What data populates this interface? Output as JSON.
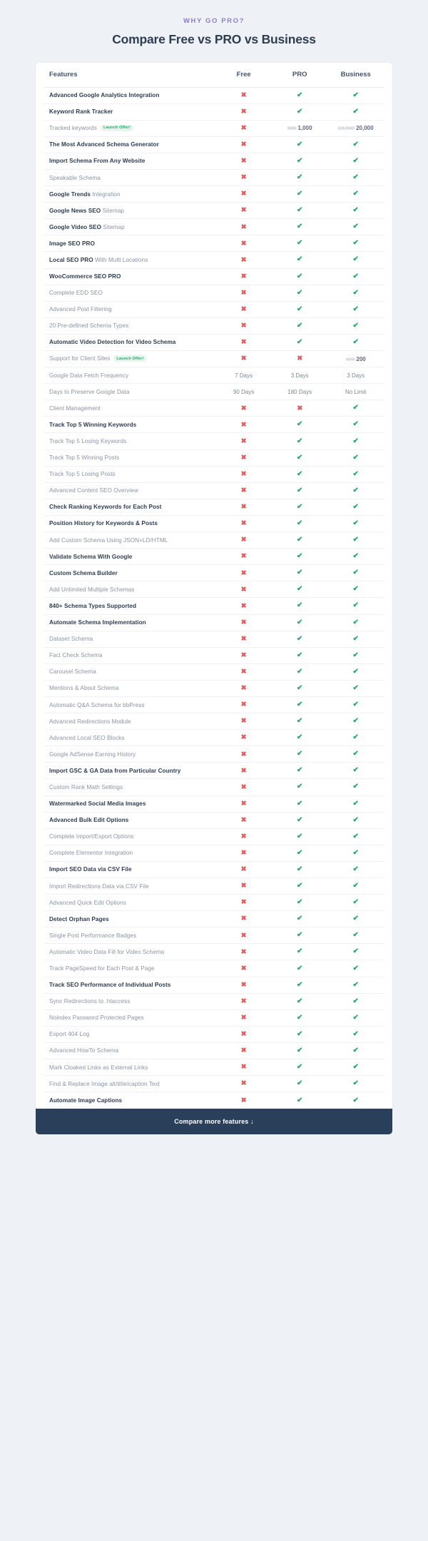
{
  "header": {
    "eyebrow": "WHY GO PRO?",
    "title": "Compare Free vs PRO vs Business"
  },
  "table": {
    "columns": [
      "Features",
      "Free",
      "PRO",
      "Business"
    ],
    "badge_label": "Launch Offer!",
    "icons": {
      "cross": "✖",
      "check": "✔"
    },
    "rows": [
      {
        "feature": "Advanced Google Analytics Integration",
        "bold": true,
        "free": "cross",
        "pro": "check",
        "business": "check"
      },
      {
        "feature": "Keyword Rank Tracker",
        "bold": true,
        "free": "cross",
        "pro": "check",
        "business": "check"
      },
      {
        "feature": "Tracked keywords",
        "bold": false,
        "badge": true,
        "free": "cross",
        "pro": {
          "old": "500",
          "new": "1,000"
        },
        "business": {
          "old": "10,000",
          "new": "20,000"
        }
      },
      {
        "feature": "The Most Advanced Schema Generator",
        "bold": true,
        "free": "cross",
        "pro": "check",
        "business": "check"
      },
      {
        "feature": "Import Schema From Any Website",
        "bold": true,
        "free": "cross",
        "pro": "check",
        "business": "check"
      },
      {
        "feature": "Speakable Schema",
        "bold": false,
        "free": "cross",
        "pro": "check",
        "business": "check"
      },
      {
        "feature": "Google Trends",
        "suffix": " Integration",
        "bold": true,
        "free": "cross",
        "pro": "check",
        "business": "check"
      },
      {
        "feature": "Google News SEO",
        "suffix": " Sitemap",
        "bold": true,
        "free": "cross",
        "pro": "check",
        "business": "check"
      },
      {
        "feature": "Google Video SEO",
        "suffix": " Sitemap",
        "bold": true,
        "free": "cross",
        "pro": "check",
        "business": "check"
      },
      {
        "feature": "Image SEO PRO",
        "bold": true,
        "free": "cross",
        "pro": "check",
        "business": "check"
      },
      {
        "feature": "Local SEO PRO",
        "suffix": " With Multi Locations",
        "bold": true,
        "free": "cross",
        "pro": "check",
        "business": "check"
      },
      {
        "feature": "WooCommerce SEO PRO",
        "bold": true,
        "free": "cross",
        "pro": "check",
        "business": "check"
      },
      {
        "feature": "Complete EDD SEO",
        "bold": false,
        "free": "cross",
        "pro": "check",
        "business": "check"
      },
      {
        "feature": "Advanced Post Filtering",
        "bold": false,
        "free": "cross",
        "pro": "check",
        "business": "check"
      },
      {
        "feature": "20 Pre-defined Schema Types",
        "bold": false,
        "free": "cross",
        "pro": "check",
        "business": "check"
      },
      {
        "feature": "Automatic Video Detection for Video Schema",
        "bold": true,
        "free": "cross",
        "pro": "check",
        "business": "check"
      },
      {
        "feature": "Support for Client Sites",
        "bold": false,
        "badge": true,
        "free": "cross",
        "pro": "cross",
        "business": {
          "old": "100",
          "new": "200"
        }
      },
      {
        "feature": "Google Data Fetch Frequency",
        "bold": false,
        "free": "7 Days",
        "pro": "3 Days",
        "business": "3 Days"
      },
      {
        "feature": "Days to Preserve Google Data",
        "bold": false,
        "free": "90 Days",
        "pro": "180 Days",
        "business": "No Limit"
      },
      {
        "feature": "Client Management",
        "bold": false,
        "free": "cross",
        "pro": "cross",
        "business": "check"
      },
      {
        "feature": "Track Top 5 Winning Keywords",
        "bold": true,
        "free": "cross",
        "pro": "check",
        "business": "check"
      },
      {
        "feature": "Track Top 5 Losing Keywords",
        "bold": false,
        "free": "cross",
        "pro": "check",
        "business": "check"
      },
      {
        "feature": "Track Top 5 Winning Posts",
        "bold": false,
        "free": "cross",
        "pro": "check",
        "business": "check"
      },
      {
        "feature": "Track Top 5 Losing Posts",
        "bold": false,
        "free": "cross",
        "pro": "check",
        "business": "check"
      },
      {
        "feature": "Advanced Content SEO Overview",
        "bold": false,
        "free": "cross",
        "pro": "check",
        "business": "check"
      },
      {
        "feature": "Check Ranking Keywords for Each Post",
        "bold": true,
        "free": "cross",
        "pro": "check",
        "business": "check"
      },
      {
        "feature": "Position History for Keywords & Posts",
        "bold": true,
        "free": "cross",
        "pro": "check",
        "business": "check"
      },
      {
        "feature": "Add Custom Schema Using JSON+LD/HTML",
        "bold": false,
        "free": "cross",
        "pro": "check",
        "business": "check"
      },
      {
        "feature": "Validate Schema With Google",
        "bold": true,
        "free": "cross",
        "pro": "check",
        "business": "check"
      },
      {
        "feature": "Custom Schema Builder",
        "bold": true,
        "free": "cross",
        "pro": "check",
        "business": "check"
      },
      {
        "feature": "Add Unlimited Multiple Schemas",
        "bold": false,
        "free": "cross",
        "pro": "check",
        "business": "check"
      },
      {
        "feature": "840+ Schema Types Supported",
        "bold": true,
        "free": "cross",
        "pro": "check",
        "business": "check"
      },
      {
        "feature": "Automate Schema Implementation",
        "bold": true,
        "free": "cross",
        "pro": "check",
        "business": "check"
      },
      {
        "feature": "Dataset Schema",
        "bold": false,
        "free": "cross",
        "pro": "check",
        "business": "check"
      },
      {
        "feature": "Fact Check Schema",
        "bold": false,
        "free": "cross",
        "pro": "check",
        "business": "check"
      },
      {
        "feature": "Carousel Schema",
        "bold": false,
        "free": "cross",
        "pro": "check",
        "business": "check"
      },
      {
        "feature": "Mentions & About Schema",
        "bold": false,
        "free": "cross",
        "pro": "check",
        "business": "check"
      },
      {
        "feature": "Automatic Q&A Schema for bbPress",
        "bold": false,
        "free": "cross",
        "pro": "check",
        "business": "check"
      },
      {
        "feature": "Advanced Redirections Module",
        "bold": false,
        "free": "cross",
        "pro": "check",
        "business": "check"
      },
      {
        "feature": "Advanced Local SEO Blocks",
        "bold": false,
        "free": "cross",
        "pro": "check",
        "business": "check"
      },
      {
        "feature": "Google AdSense Earning History",
        "bold": false,
        "free": "cross",
        "pro": "check",
        "business": "check"
      },
      {
        "feature": "Import GSC & GA Data from Particular Country",
        "bold": true,
        "free": "cross",
        "pro": "check",
        "business": "check"
      },
      {
        "feature": "Custom Rank Math Settings",
        "bold": false,
        "free": "cross",
        "pro": "check",
        "business": "check"
      },
      {
        "feature": "Watermarked Social Media Images",
        "bold": true,
        "free": "cross",
        "pro": "check",
        "business": "check"
      },
      {
        "feature": "Advanced Bulk Edit Options",
        "bold": true,
        "free": "cross",
        "pro": "check",
        "business": "check"
      },
      {
        "feature": "Complete Import/Export Options",
        "bold": false,
        "free": "cross",
        "pro": "check",
        "business": "check"
      },
      {
        "feature": "Complete Elementor Integration",
        "bold": false,
        "free": "cross",
        "pro": "check",
        "business": "check"
      },
      {
        "feature": "Import SEO Data via CSV File",
        "bold": true,
        "free": "cross",
        "pro": "check",
        "business": "check"
      },
      {
        "feature": "Import Redirections Data via CSV File",
        "bold": false,
        "free": "cross",
        "pro": "check",
        "business": "check"
      },
      {
        "feature": "Advanced Quick Edit Options",
        "bold": false,
        "free": "cross",
        "pro": "check",
        "business": "check"
      },
      {
        "feature": "Detect Orphan Pages",
        "bold": true,
        "free": "cross",
        "pro": "check",
        "business": "check"
      },
      {
        "feature": "Single Post Performance Badges",
        "bold": false,
        "free": "cross",
        "pro": "check",
        "business": "check"
      },
      {
        "feature": "Automatic Video Data Fill for Video Schema",
        "bold": false,
        "free": "cross",
        "pro": "check",
        "business": "check"
      },
      {
        "feature": "Track PageSpeed for Each Post & Page",
        "bold": false,
        "free": "cross",
        "pro": "check",
        "business": "check"
      },
      {
        "feature": "Track SEO Performance of Individual Posts",
        "bold": true,
        "free": "cross",
        "pro": "check",
        "business": "check"
      },
      {
        "feature": "Sync Redirections to .htaccess",
        "bold": false,
        "free": "cross",
        "pro": "check",
        "business": "check"
      },
      {
        "feature": "Noindex Password Protected Pages",
        "bold": false,
        "free": "cross",
        "pro": "check",
        "business": "check"
      },
      {
        "feature": "Export 404 Log",
        "bold": false,
        "free": "cross",
        "pro": "check",
        "business": "check"
      },
      {
        "feature": "Advanced HowTo Schema",
        "bold": false,
        "free": "cross",
        "pro": "check",
        "business": "check"
      },
      {
        "feature": "Mark Cloaked Links as External Links",
        "bold": false,
        "free": "cross",
        "pro": "check",
        "business": "check"
      },
      {
        "feature": "Find & Replace Image alt/title/caption Text",
        "bold": false,
        "free": "cross",
        "pro": "check",
        "business": "check"
      },
      {
        "feature": "Automate Image Captions",
        "bold": true,
        "free": "cross",
        "pro": "check",
        "business": "check"
      }
    ]
  },
  "cta": {
    "label": "Compare more features ↓"
  },
  "colors": {
    "page_bg": "#eef2f7",
    "card_bg": "#ffffff",
    "eyebrow": "#8b7fc7",
    "heading": "#2e3d50",
    "cross": "#e05b5b",
    "check": "#2aa86c",
    "badge_bg": "#e4f6ed",
    "badge_fg": "#2aa86c",
    "cta_bg": "#2a3f5a"
  }
}
